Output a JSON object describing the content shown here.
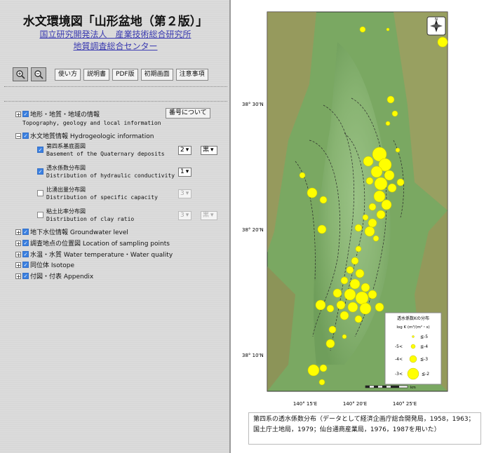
{
  "header": {
    "title": "水文環境図「山形盆地（第２版）」",
    "org_line1": "国立研究開発法人　産業技術総合研究所",
    "org_line2": "地質調査総合センター"
  },
  "toolbar": {
    "zoom_in_icon": "zoom-in-icon",
    "zoom_out_icon": "zoom-out-icon",
    "buttons": [
      "使い方",
      "説明書",
      "PDF版",
      "初期画面",
      "注意事項"
    ]
  },
  "layers": {
    "number_button": "番号について",
    "topo": {
      "label": "地形・地質・地域の情報",
      "en": "Topography, geology and local information"
    },
    "hydro": {
      "label": "水文地質情報 Hydrogeologic information"
    },
    "sub": [
      {
        "ja": "第四系基底面図",
        "en": "Basement of the Quaternary deposits",
        "checked": true,
        "select1": "2",
        "select2": "黒"
      },
      {
        "ja": "透水係数分布図",
        "en": "Distribution of hydraulic conductivity",
        "checked": true,
        "select1": "1"
      },
      {
        "ja": "比湧出量分布図",
        "en": "Distribution of specific capacity",
        "checked": false,
        "select1": "3"
      },
      {
        "ja": "粘土比率分布図",
        "en": "Distribution of clay ratio",
        "checked": false,
        "select1": "3",
        "select2": "黒"
      }
    ],
    "groundwater": "地下水位情報 Groundwater level",
    "sampling": "調査地点の位置図 Location of sampling points",
    "quality": "水温・水質 Water temperature・Water quality",
    "isotope": "同位体 Isotope",
    "appendix": "付図・付表 Appendix"
  },
  "map": {
    "lat_labels": [
      "38° 30'N",
      "38° 20'N",
      "38° 10'N"
    ],
    "lon_labels": [
      "140° 15'E",
      "140° 20'E",
      "140° 25'E"
    ],
    "legend": {
      "title": "透水係数Kの分布",
      "unit": "log K (m³/(m²・s)",
      "items": [
        "≦-5",
        "-5<",
        "≦-4",
        "-4<",
        "≦-3",
        "-3<",
        "≦-2"
      ]
    },
    "scale_label": "km",
    "scale_ticks": [
      "0",
      "1",
      "2",
      "3",
      "4",
      "5",
      "10"
    ],
    "compass": "N"
  },
  "caption": {
    "line1": "第四系の透水係数分布（データとして経済企画庁総合開発局，1958，1963；",
    "line2": "国土庁土地局，1979；仙台通商産業局，1976，1987を用いた）"
  },
  "colors": {
    "accent_link": "#3a3ab0",
    "checkbox": "#3b80e0",
    "dot": "#ffff00"
  }
}
